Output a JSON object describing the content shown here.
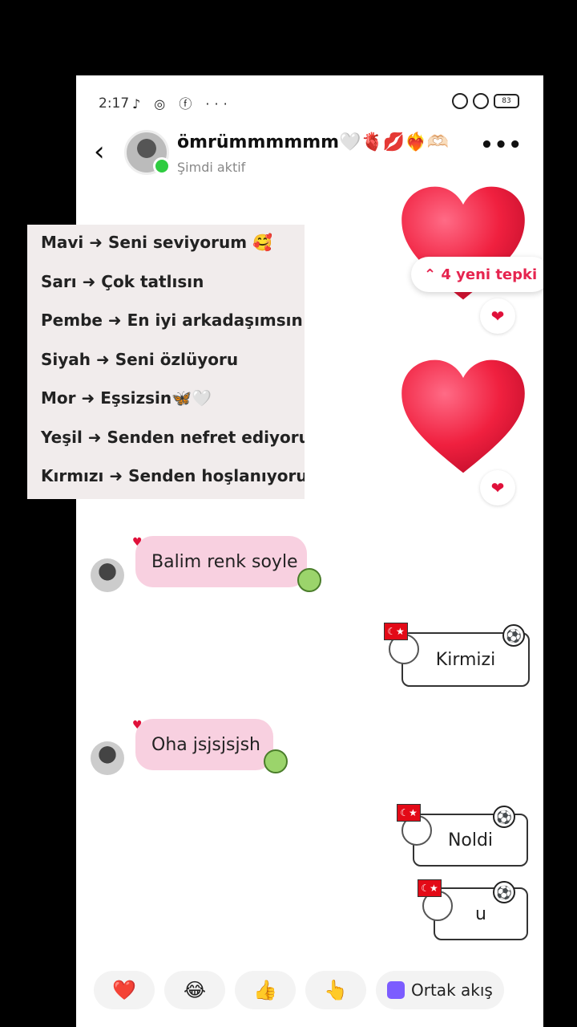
{
  "status_bar": {
    "time": "2:17",
    "app_icons": "♪ ◎ ⓕ ···",
    "battery": "83"
  },
  "header": {
    "back_icon": "chevron-left-icon",
    "name": "ömrümmmmmm🤍🫀💋❤️‍🔥🫶🏻",
    "status": "Şimdi aktif",
    "more_icon": "more-icon"
  },
  "reactions": {
    "new_label": "⌃ 4 yeni tepki",
    "heart": "❤"
  },
  "overlay_list": [
    "Mavi ➜ Seni seviyorum 🥰",
    "Sarı ➜ Çok tatlısın",
    "Pembe ➜ En iyi arkadaşımsın",
    "Siyah ➜ Seni özlüyoru",
    "Mor ➜ Eşsizsin🦋🤍",
    "Yeşil ➜ Senden nefret ediyorum",
    "Kırmızı ➜ Senden hoşlanıyorum"
  ],
  "messages": [
    {
      "direction": "in",
      "text": "Balim renk soyle"
    },
    {
      "direction": "out",
      "text": "Kirmizi"
    },
    {
      "direction": "in",
      "text": "Oha jsjsjsjsh"
    },
    {
      "direction": "out",
      "text": "Noldi"
    },
    {
      "direction": "out",
      "text": "u"
    }
  ],
  "quick_bar": {
    "heart": "❤️",
    "laugh": "😂",
    "thumbs": "👍",
    "point": "👆",
    "shared_feed": "Ortak akış"
  },
  "colors": {
    "incoming_bubble": "#f8d0e0",
    "accent": "#e6244f",
    "online": "#2ecc40"
  }
}
